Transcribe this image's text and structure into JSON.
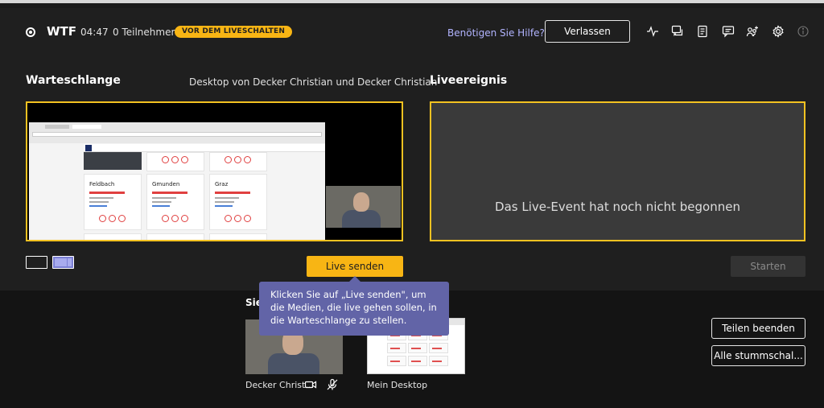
{
  "header": {
    "title": "WTF",
    "elapsed": "04:47",
    "participants": "0 Teilnehmer",
    "badge": "VOR DEM LIVESCHALTEN",
    "help_link": "Benötigen Sie Hilfe?",
    "leave_label": "Verlassen",
    "icons": [
      "health-icon",
      "qna-icon",
      "notes-icon",
      "chat-icon",
      "people-icon",
      "settings-icon",
      "info-icon"
    ]
  },
  "queue": {
    "title": "Warteschlange",
    "subtitle": "Desktop von Decker Christian und Decker Christian",
    "cards": [
      "Feldbach",
      "Gmunden",
      "Graz"
    ]
  },
  "live": {
    "title": "Liveereignis",
    "message": "Das Live-Event hat noch nicht begonnen"
  },
  "controls": {
    "send_label": "Live senden",
    "start_label": "Starten"
  },
  "tooltip": {
    "text": "Klicken Sie auf „Live senden\", um die Medien, die live gehen sollen, in die Warteschlange zu stellen."
  },
  "sources": {
    "title": "Sie",
    "camera_label": "Decker Christ...",
    "desktop_label": "Mein Desktop"
  },
  "actions": {
    "stop_sharing": "Teilen beenden",
    "mute_all": "Alle stummschal..."
  },
  "colors": {
    "accent": "#f8b514",
    "frame": "#f3c221",
    "tooltip": "#6264a7",
    "link": "#b2b4ff"
  }
}
